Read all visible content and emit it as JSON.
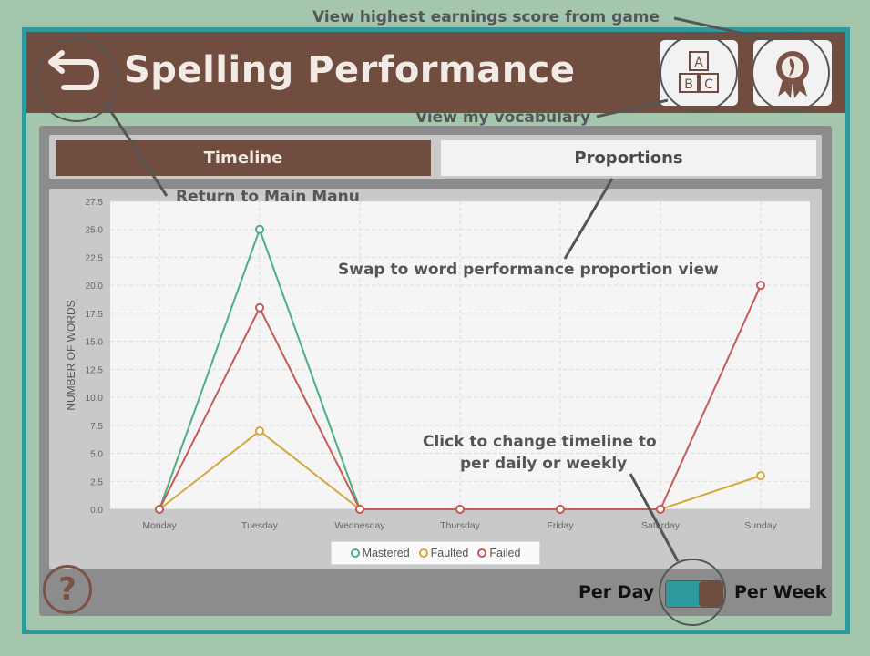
{
  "header": {
    "title": "Spelling Performance",
    "back_icon": "back-arrow-icon",
    "vocab_icon": "abc-blocks-icon",
    "vocab_letters": [
      "A",
      "B",
      "C"
    ],
    "award_icon": "award-ribbon-icon"
  },
  "tabs": [
    {
      "label": "Timeline",
      "active": true
    },
    {
      "label": "Proportions",
      "active": false
    }
  ],
  "chart_data": {
    "type": "line",
    "categories": [
      "Monday",
      "Tuesday",
      "Wednesday",
      "Thursday",
      "Friday",
      "Saturday",
      "Sunday"
    ],
    "series": [
      {
        "name": "Mastered",
        "color": "#4caf82",
        "values": [
          0,
          25,
          0,
          0,
          0,
          0,
          null
        ]
      },
      {
        "name": "Faulted",
        "color": "#d4a83a",
        "values": [
          0,
          7,
          0,
          0,
          0,
          0,
          3
        ]
      },
      {
        "name": "Failed",
        "color": "#c85a5a",
        "values": [
          0,
          18,
          0,
          0,
          0,
          0,
          20
        ]
      }
    ],
    "ylabel": "NUMBER OF WORDS",
    "yticks": [
      "0.0",
      "2.5",
      "5.0",
      "7.5",
      "10.0",
      "12.5",
      "15.0",
      "17.5",
      "20.0",
      "22.5",
      "25.0",
      "27.5"
    ],
    "ylim": [
      0,
      27.5
    ],
    "grid": true,
    "legend_position": "bottom"
  },
  "footer": {
    "help_label": "?",
    "per_day": "Per Day",
    "per_week": "Per Week"
  },
  "annotations": {
    "highest_score": "View highest earnings score from game",
    "vocabulary": "View my vocabulary",
    "return_menu": "Return to Main Manu",
    "swap_view": "Swap to word performance proportion view",
    "timeline_line1": "Click to change timeline to",
    "timeline_line2": "per daily or weekly"
  },
  "colors": {
    "brown": "#714d40",
    "teal": "#2f9a9e",
    "background": "#a3c6ad",
    "panel": "#8c8c8c"
  }
}
